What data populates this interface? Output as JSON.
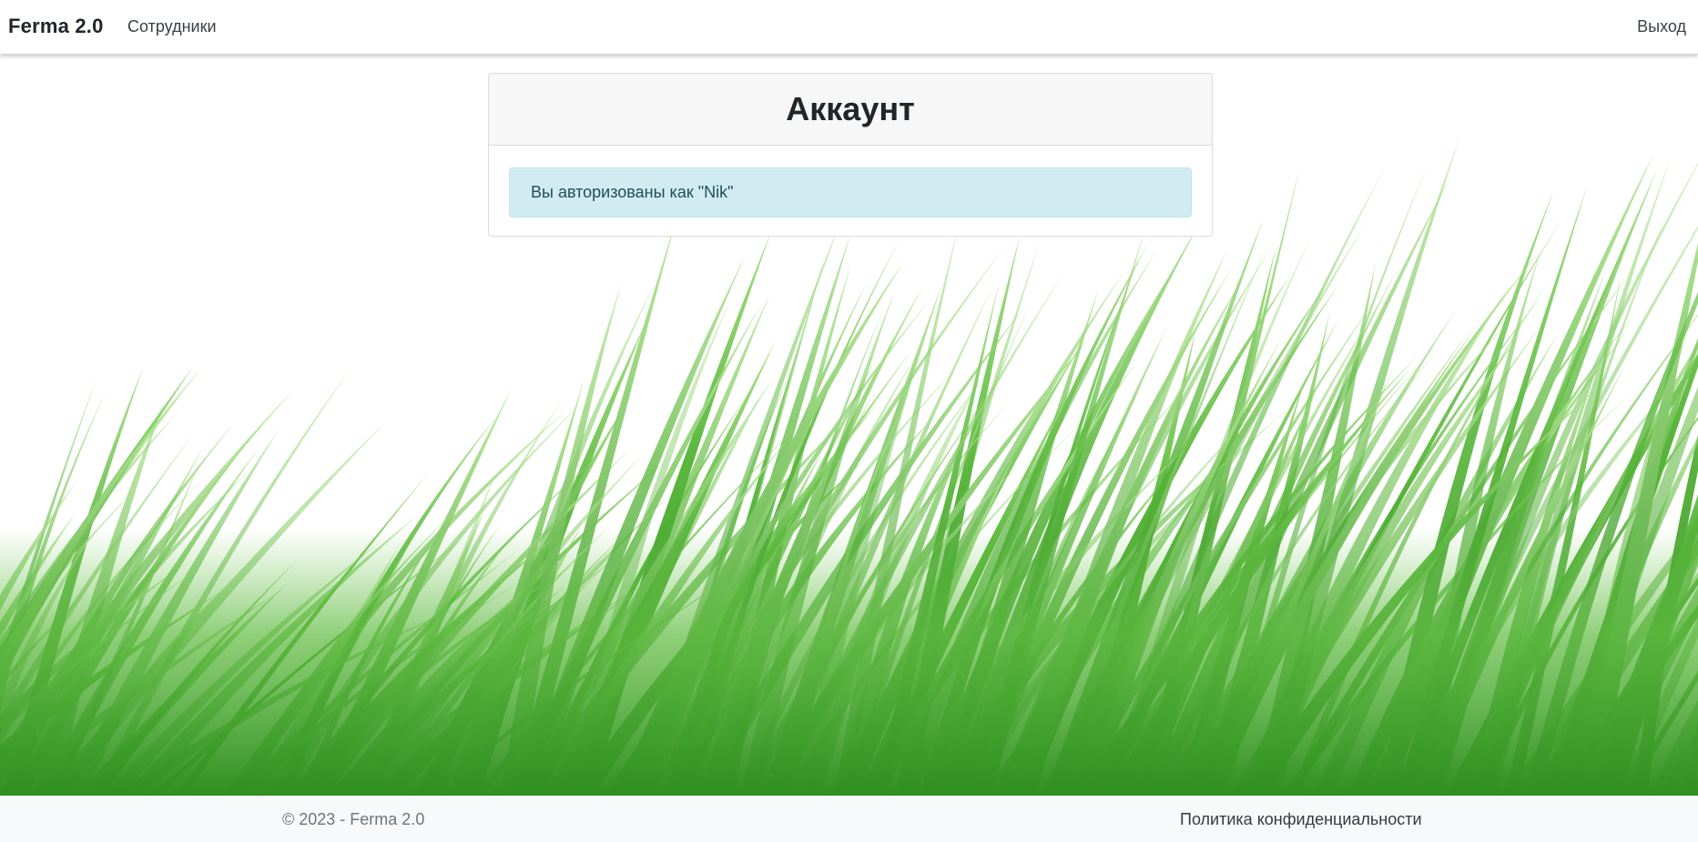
{
  "navbar": {
    "brand": "Ferma 2.0",
    "employees_link": "Сотрудники",
    "logout_link": "Выход"
  },
  "account_card": {
    "title": "Аккаунт",
    "alert_text": "Вы авторизованы как \"Nik\""
  },
  "footer": {
    "copyright": "© 2023 - Ferma 2.0",
    "privacy_link": "Политика конфиденциальности"
  },
  "colors": {
    "alert_background": "#d1ecf1",
    "grass_light": "#8ed66a",
    "grass_dark": "#2f8f1f",
    "footer_background": "#f8f9fa"
  }
}
